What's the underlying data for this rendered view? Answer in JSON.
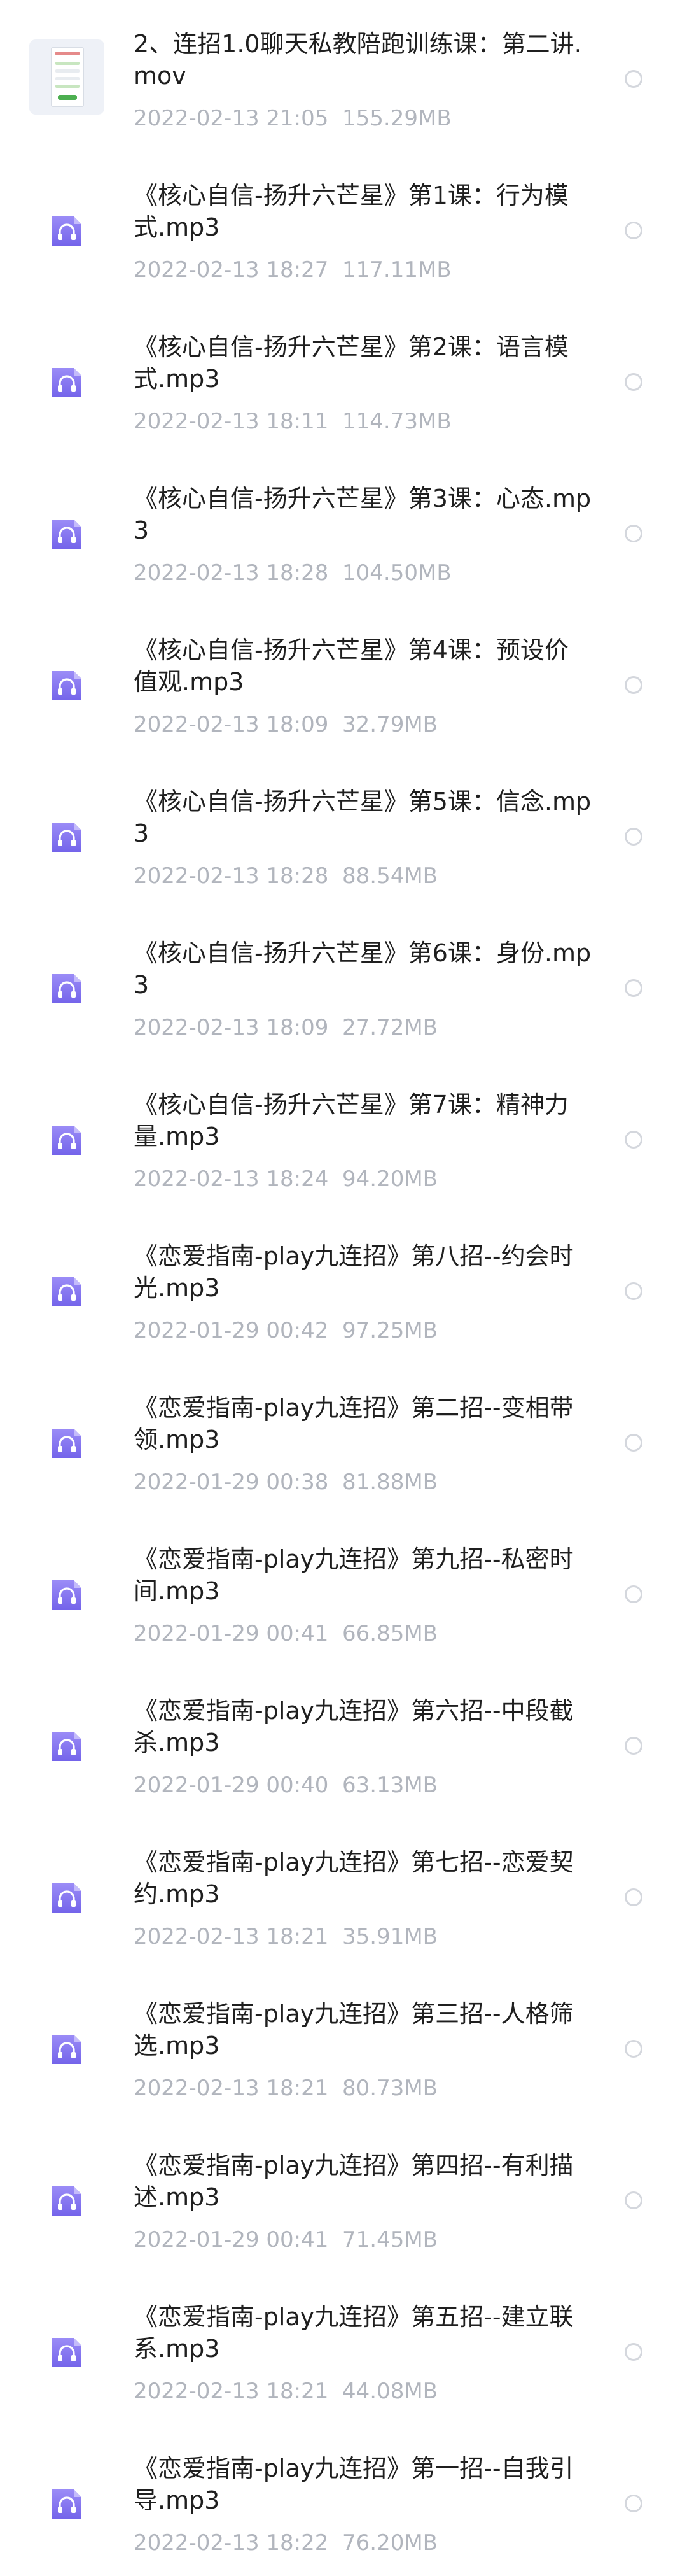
{
  "files": [
    {
      "kind": "video",
      "name": "2、连招1.0聊天私教陪跑训练课：第二讲.mov",
      "date": "2022-02-13",
      "time": "21:05",
      "size": "155.29MB"
    },
    {
      "kind": "audio",
      "name": "《核心自信-扬升六芒星》第1课：行为模式.mp3",
      "date": "2022-02-13",
      "time": "18:27",
      "size": "117.11MB"
    },
    {
      "kind": "audio",
      "name": "《核心自信-扬升六芒星》第2课：语言模式.mp3",
      "date": "2022-02-13",
      "time": "18:11",
      "size": "114.73MB"
    },
    {
      "kind": "audio",
      "name": "《核心自信-扬升六芒星》第3课：心态.mp3",
      "date": "2022-02-13",
      "time": "18:28",
      "size": "104.50MB"
    },
    {
      "kind": "audio",
      "name": "《核心自信-扬升六芒星》第4课：预设价值观.mp3",
      "date": "2022-02-13",
      "time": "18:09",
      "size": "32.79MB"
    },
    {
      "kind": "audio",
      "name": "《核心自信-扬升六芒星》第5课：信念.mp3",
      "date": "2022-02-13",
      "time": "18:28",
      "size": "88.54MB"
    },
    {
      "kind": "audio",
      "name": "《核心自信-扬升六芒星》第6课：身份.mp3",
      "date": "2022-02-13",
      "time": "18:09",
      "size": "27.72MB"
    },
    {
      "kind": "audio",
      "name": "《核心自信-扬升六芒星》第7课：精神力量.mp3",
      "date": "2022-02-13",
      "time": "18:24",
      "size": "94.20MB"
    },
    {
      "kind": "audio",
      "name": "《恋爱指南-play九连招》第八招--约会时光.mp3",
      "date": "2022-01-29",
      "time": "00:42",
      "size": "97.25MB"
    },
    {
      "kind": "audio",
      "name": "《恋爱指南-play九连招》第二招--变相带领.mp3",
      "date": "2022-01-29",
      "time": "00:38",
      "size": "81.88MB"
    },
    {
      "kind": "audio",
      "name": "《恋爱指南-play九连招》第九招--私密时间.mp3",
      "date": "2022-01-29",
      "time": "00:41",
      "size": "66.85MB"
    },
    {
      "kind": "audio",
      "name": "《恋爱指南-play九连招》第六招--中段截杀.mp3",
      "date": "2022-01-29",
      "time": "00:40",
      "size": "63.13MB"
    },
    {
      "kind": "audio",
      "name": "《恋爱指南-play九连招》第七招--恋爱契约.mp3",
      "date": "2022-02-13",
      "time": "18:21",
      "size": "35.91MB"
    },
    {
      "kind": "audio",
      "name": "《恋爱指南-play九连招》第三招--人格筛选.mp3",
      "date": "2022-02-13",
      "time": "18:21",
      "size": "80.73MB"
    },
    {
      "kind": "audio",
      "name": "《恋爱指南-play九连招》第四招--有利描述.mp3",
      "date": "2022-01-29",
      "time": "00:41",
      "size": "71.45MB"
    },
    {
      "kind": "audio",
      "name": "《恋爱指南-play九连招》第五招--建立联系.mp3",
      "date": "2022-02-13",
      "time": "18:21",
      "size": "44.08MB"
    },
    {
      "kind": "audio",
      "name": "《恋爱指南-play九连招》第一招--自我引导.mp3",
      "date": "2022-02-13",
      "time": "18:22",
      "size": "76.20MB"
    }
  ],
  "icons": {
    "audio": "headphones-icon",
    "video": "video-thumbnail",
    "select": "radio-circle-icon"
  },
  "colors": {
    "audio_icon_top": "#9b8cf7",
    "audio_icon_bottom": "#7b6bee",
    "meta_text": "#b1b5bd",
    "radio_border": "#d4d7dd"
  }
}
